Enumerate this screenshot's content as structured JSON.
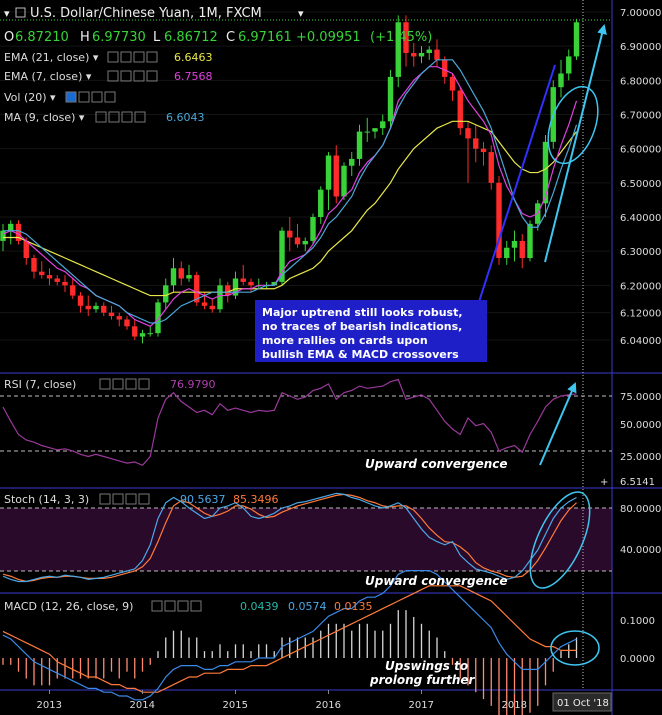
{
  "header": {
    "symbol": "U.S. Dollar/Chinese Yuan, 1M, FXCM",
    "ohlc": {
      "o_label": "O",
      "o": "6.87210",
      "h_label": "H",
      "h": "6.97730",
      "l_label": "L",
      "l": "6.86712",
      "c_label": "C",
      "c": "6.97161",
      "chg": "+0.09951",
      "chg_pct": "(+1.45%)"
    }
  },
  "indicators": {
    "ema21": {
      "label": "EMA (21, close)",
      "value": "6.6463",
      "color": "#e8e84a"
    },
    "ema7": {
      "label": "EMA (7, close)",
      "value": "6.7568",
      "color": "#e040e0"
    },
    "vol": {
      "label": "Vol (20)"
    },
    "ma9": {
      "label": "MA (9, close)",
      "value": "6.6043",
      "color": "#4aa8d8"
    }
  },
  "annotations": {
    "box": [
      "Major uptrend still looks robust,",
      "no traces of bearish indications,",
      "more rallies on cards upon",
      "bullish EMA & MACD crossovers"
    ],
    "rsi_note": "Upward convergence",
    "stoch_note": "Upward convergence",
    "macd_note": [
      "Upswings to",
      "prolong further"
    ]
  },
  "rsi": {
    "label": "RSI (7, close)",
    "value": "76.9790",
    "ticks": [
      "75.0000",
      "50.0000",
      "25.0000"
    ],
    "side_value": "6.5141"
  },
  "stoch": {
    "label": "Stoch (14, 3, 3)",
    "k": "90.5637",
    "d": "85.3496",
    "ticks": [
      "80.0000",
      "40.0000"
    ]
  },
  "macd": {
    "label": "MACD (12, 26, close, 9)",
    "v1": "0.0439",
    "v2": "0.0574",
    "v3": "0.0135",
    "ticks": [
      "0.1000",
      "0.0000"
    ]
  },
  "price_axis": [
    "7.00000",
    "6.90000",
    "6.80000",
    "6.70000",
    "6.60000",
    "6.50000",
    "6.40000",
    "6.30000",
    "6.20000",
    "6.12000",
    "6.04000"
  ],
  "time_axis": [
    "2013",
    "2014",
    "2015",
    "2016",
    "2017",
    "2018"
  ],
  "cursor_label": "01 Oct '18",
  "colors": {
    "up": "#39d339",
    "down": "#ff2a2a",
    "accent": "#3bb7e8",
    "arrow": "#3ec6f0",
    "box": "#1f1fc8"
  },
  "chart_data": {
    "type": "candlestick",
    "start": "2012-07",
    "interval": "1M",
    "ylim": [
      5.98,
      7.02
    ],
    "candles": [
      [
        6.33,
        6.38,
        6.3,
        6.36
      ],
      [
        6.36,
        6.39,
        6.32,
        6.38
      ],
      [
        6.38,
        6.39,
        6.32,
        6.33
      ],
      [
        6.33,
        6.34,
        6.26,
        6.28
      ],
      [
        6.28,
        6.29,
        6.22,
        6.24
      ],
      [
        6.24,
        6.27,
        6.22,
        6.23
      ],
      [
        6.23,
        6.25,
        6.2,
        6.22
      ],
      [
        6.22,
        6.23,
        6.2,
        6.21
      ],
      [
        6.21,
        6.23,
        6.18,
        6.2
      ],
      [
        6.2,
        6.22,
        6.16,
        6.17
      ],
      [
        6.17,
        6.18,
        6.12,
        6.14
      ],
      [
        6.14,
        6.17,
        6.11,
        6.13
      ],
      [
        6.13,
        6.15,
        6.12,
        6.14
      ],
      [
        6.14,
        6.15,
        6.11,
        6.12
      ],
      [
        6.12,
        6.14,
        6.1,
        6.11
      ],
      [
        6.11,
        6.12,
        6.08,
        6.1
      ],
      [
        6.1,
        6.11,
        6.07,
        6.08
      ],
      [
        6.08,
        6.1,
        6.04,
        6.05
      ],
      [
        6.05,
        6.07,
        6.03,
        6.06
      ],
      [
        6.06,
        6.08,
        6.05,
        6.06
      ],
      [
        6.06,
        6.16,
        6.05,
        6.15
      ],
      [
        6.15,
        6.22,
        6.13,
        6.2
      ],
      [
        6.2,
        6.28,
        6.18,
        6.25
      ],
      [
        6.25,
        6.27,
        6.2,
        6.22
      ],
      [
        6.22,
        6.26,
        6.21,
        6.23
      ],
      [
        6.23,
        6.24,
        6.14,
        6.15
      ],
      [
        6.15,
        6.18,
        6.13,
        6.14
      ],
      [
        6.14,
        6.16,
        6.12,
        6.13
      ],
      [
        6.13,
        6.22,
        6.12,
        6.2
      ],
      [
        6.2,
        6.21,
        6.15,
        6.17
      ],
      [
        6.17,
        6.24,
        6.16,
        6.22
      ],
      [
        6.22,
        6.26,
        6.2,
        6.21
      ],
      [
        6.21,
        6.22,
        6.18,
        6.2
      ],
      [
        6.2,
        6.22,
        6.19,
        6.2
      ],
      [
        6.2,
        6.21,
        6.19,
        6.2
      ],
      [
        6.2,
        6.21,
        6.2,
        6.21
      ],
      [
        6.21,
        6.37,
        6.2,
        6.36
      ],
      [
        6.36,
        6.4,
        6.3,
        6.34
      ],
      [
        6.34,
        6.38,
        6.31,
        6.32
      ],
      [
        6.32,
        6.34,
        6.3,
        6.33
      ],
      [
        6.33,
        6.41,
        6.32,
        6.4
      ],
      [
        6.4,
        6.49,
        6.38,
        6.48
      ],
      [
        6.48,
        6.59,
        6.42,
        6.58
      ],
      [
        6.58,
        6.61,
        6.44,
        6.46
      ],
      [
        6.46,
        6.56,
        6.45,
        6.55
      ],
      [
        6.55,
        6.59,
        6.52,
        6.57
      ],
      [
        6.57,
        6.67,
        6.55,
        6.65
      ],
      [
        6.65,
        6.69,
        6.62,
        6.65
      ],
      [
        6.65,
        6.66,
        6.63,
        6.66
      ],
      [
        6.66,
        6.7,
        6.64,
        6.68
      ],
      [
        6.68,
        6.83,
        6.66,
        6.81
      ],
      [
        6.81,
        6.99,
        6.78,
        6.97
      ],
      [
        6.97,
        6.99,
        6.84,
        6.88
      ],
      [
        6.88,
        6.91,
        6.84,
        6.87
      ],
      [
        6.87,
        6.9,
        6.85,
        6.88
      ],
      [
        6.88,
        6.9,
        6.86,
        6.89
      ],
      [
        6.89,
        6.92,
        6.84,
        6.86
      ],
      [
        6.86,
        6.87,
        6.79,
        6.81
      ],
      [
        6.81,
        6.82,
        6.74,
        6.77
      ],
      [
        6.77,
        6.78,
        6.64,
        6.66
      ],
      [
        6.66,
        6.68,
        6.5,
        6.63
      ],
      [
        6.63,
        6.67,
        6.56,
        6.6
      ],
      [
        6.6,
        6.62,
        6.55,
        6.59
      ],
      [
        6.59,
        6.61,
        6.48,
        6.5
      ],
      [
        6.5,
        6.52,
        6.26,
        6.28
      ],
      [
        6.28,
        6.33,
        6.26,
        6.31
      ],
      [
        6.31,
        6.36,
        6.27,
        6.33
      ],
      [
        6.33,
        6.35,
        6.25,
        6.28
      ],
      [
        6.28,
        6.39,
        6.27,
        6.38
      ],
      [
        6.38,
        6.45,
        6.36,
        6.44
      ],
      [
        6.44,
        6.64,
        6.4,
        6.62
      ],
      [
        6.62,
        6.8,
        6.6,
        6.78
      ],
      [
        6.78,
        6.86,
        6.75,
        6.82
      ],
      [
        6.82,
        6.89,
        6.8,
        6.87
      ],
      [
        6.87,
        6.98,
        6.86,
        6.97
      ]
    ],
    "ema21": [
      6.34,
      6.34,
      6.34,
      6.33,
      6.32,
      6.31,
      6.3,
      6.29,
      6.28,
      6.27,
      6.26,
      6.25,
      6.24,
      6.23,
      6.22,
      6.21,
      6.2,
      6.19,
      6.18,
      6.17,
      6.17,
      6.17,
      6.18,
      6.18,
      6.18,
      6.18,
      6.18,
      6.18,
      6.18,
      6.18,
      6.19,
      6.19,
      6.19,
      6.19,
      6.19,
      6.19,
      6.2,
      6.22,
      6.23,
      6.24,
      6.25,
      6.27,
      6.3,
      6.32,
      6.34,
      6.36,
      6.39,
      6.42,
      6.44,
      6.47,
      6.5,
      6.54,
      6.57,
      6.6,
      6.62,
      6.64,
      6.66,
      6.67,
      6.68,
      6.68,
      6.68,
      6.67,
      6.66,
      6.65,
      6.62,
      6.59,
      6.56,
      6.54,
      6.53,
      6.53,
      6.54,
      6.56,
      6.59,
      6.62,
      6.65
    ],
    "ema7": [
      6.35,
      6.36,
      6.35,
      6.33,
      6.31,
      6.29,
      6.27,
      6.25,
      6.24,
      6.22,
      6.2,
      6.19,
      6.17,
      6.16,
      6.15,
      6.14,
      6.12,
      6.1,
      6.09,
      6.08,
      6.1,
      6.13,
      6.16,
      6.18,
      6.19,
      6.18,
      6.17,
      6.16,
      6.17,
      6.17,
      6.18,
      6.19,
      6.19,
      6.2,
      6.2,
      6.2,
      6.24,
      6.27,
      6.28,
      6.29,
      6.32,
      6.36,
      6.41,
      6.43,
      6.46,
      6.48,
      6.53,
      6.56,
      6.58,
      6.61,
      6.66,
      6.74,
      6.77,
      6.8,
      6.82,
      6.84,
      6.84,
      6.83,
      6.82,
      6.78,
      6.74,
      6.71,
      6.68,
      6.64,
      6.55,
      6.49,
      6.45,
      6.41,
      6.4,
      6.41,
      6.46,
      6.54,
      6.61,
      6.67,
      6.74
    ],
    "ma9": [
      6.36,
      6.36,
      6.36,
      6.35,
      6.33,
      6.31,
      6.29,
      6.27,
      6.25,
      6.23,
      6.21,
      6.19,
      6.17,
      6.16,
      6.15,
      6.14,
      6.12,
      6.11,
      6.1,
      6.09,
      6.09,
      6.1,
      6.12,
      6.14,
      6.15,
      6.16,
      6.17,
      6.18,
      6.18,
      6.18,
      6.18,
      6.18,
      6.18,
      6.19,
      6.2,
      6.2,
      6.23,
      6.25,
      6.27,
      6.29,
      6.31,
      6.34,
      6.38,
      6.4,
      6.43,
      6.46,
      6.51,
      6.55,
      6.58,
      6.61,
      6.66,
      6.72,
      6.76,
      6.79,
      6.82,
      6.84,
      6.86,
      6.86,
      6.86,
      6.83,
      6.79,
      6.75,
      6.71,
      6.66,
      6.59,
      6.52,
      6.45,
      6.4,
      6.37,
      6.37,
      6.41,
      6.47,
      6.54,
      6.6,
      6.67
    ],
    "rsi": [
      65,
      52,
      40,
      35,
      33,
      30,
      28,
      26,
      27,
      25,
      22,
      20,
      22,
      20,
      18,
      16,
      14,
      15,
      12,
      20,
      55,
      72,
      78,
      70,
      65,
      60,
      62,
      58,
      68,
      62,
      64,
      62,
      60,
      62,
      61,
      62,
      78,
      75,
      72,
      74,
      80,
      82,
      86,
      72,
      78,
      80,
      84,
      82,
      83,
      84,
      88,
      90,
      72,
      74,
      76,
      72,
      62,
      52,
      45,
      40,
      55,
      48,
      50,
      42,
      25,
      28,
      30,
      24,
      40,
      52,
      65,
      72,
      75,
      76,
      77
    ],
    "stoch_k": [
      15,
      12,
      10,
      10,
      12,
      14,
      15,
      14,
      16,
      15,
      14,
      12,
      13,
      14,
      16,
      18,
      20,
      22,
      30,
      45,
      70,
      85,
      90,
      86,
      80,
      75,
      70,
      72,
      80,
      82,
      85,
      80,
      72,
      70,
      72,
      75,
      80,
      82,
      85,
      86,
      88,
      90,
      92,
      94,
      93,
      90,
      88,
      85,
      82,
      80,
      82,
      85,
      80,
      70,
      60,
      52,
      48,
      45,
      48,
      35,
      28,
      22,
      20,
      18,
      15,
      12,
      14,
      20,
      30,
      40,
      55,
      70,
      80,
      86,
      90
    ],
    "stoch_d": [
      17,
      15,
      12,
      10,
      11,
      13,
      14,
      14,
      15,
      15,
      14,
      13,
      13,
      13,
      14,
      16,
      18,
      20,
      24,
      32,
      48,
      66,
      82,
      87,
      85,
      80,
      75,
      72,
      74,
      77,
      82,
      82,
      79,
      74,
      71,
      72,
      76,
      79,
      82,
      84,
      86,
      88,
      90,
      92,
      93,
      92,
      90,
      87,
      85,
      82,
      81,
      82,
      82,
      78,
      70,
      61,
      54,
      48,
      47,
      43,
      37,
      28,
      23,
      20,
      18,
      15,
      14,
      15,
      21,
      30,
      42,
      55,
      68,
      78,
      85
    ],
    "macd": [
      0.06,
      0.05,
      0.03,
      0.01,
      -0.01,
      -0.02,
      -0.03,
      -0.04,
      -0.05,
      -0.06,
      -0.07,
      -0.08,
      -0.08,
      -0.09,
      -0.09,
      -0.1,
      -0.1,
      -0.11,
      -0.11,
      -0.1,
      -0.08,
      -0.05,
      -0.03,
      -0.02,
      -0.02,
      -0.02,
      -0.03,
      -0.03,
      -0.02,
      -0.02,
      -0.01,
      -0.01,
      -0.01,
      0.0,
      0.0,
      0.0,
      0.03,
      0.04,
      0.05,
      0.06,
      0.07,
      0.09,
      0.11,
      0.12,
      0.13,
      0.13,
      0.15,
      0.16,
      0.16,
      0.17,
      0.19,
      0.22,
      0.23,
      0.23,
      0.23,
      0.23,
      0.22,
      0.2,
      0.18,
      0.16,
      0.14,
      0.12,
      0.1,
      0.08,
      0.04,
      0.01,
      -0.01,
      -0.03,
      -0.03,
      -0.03,
      -0.01,
      0.01,
      0.03,
      0.04,
      0.05
    ],
    "signal": [
      0.07,
      0.06,
      0.05,
      0.04,
      0.03,
      0.02,
      0.01,
      -0.01,
      -0.02,
      -0.03,
      -0.04,
      -0.05,
      -0.05,
      -0.06,
      -0.07,
      -0.07,
      -0.08,
      -0.08,
      -0.09,
      -0.09,
      -0.09,
      -0.08,
      -0.07,
      -0.06,
      -0.05,
      -0.05,
      -0.04,
      -0.04,
      -0.04,
      -0.03,
      -0.03,
      -0.03,
      -0.02,
      -0.02,
      -0.02,
      -0.01,
      0.0,
      0.01,
      0.02,
      0.03,
      0.04,
      0.05,
      0.06,
      0.07,
      0.08,
      0.09,
      0.1,
      0.11,
      0.12,
      0.13,
      0.14,
      0.15,
      0.16,
      0.17,
      0.18,
      0.19,
      0.19,
      0.19,
      0.19,
      0.19,
      0.18,
      0.17,
      0.16,
      0.15,
      0.13,
      0.11,
      0.09,
      0.07,
      0.05,
      0.04,
      0.03,
      0.03,
      0.02,
      0.02,
      0.02
    ]
  }
}
